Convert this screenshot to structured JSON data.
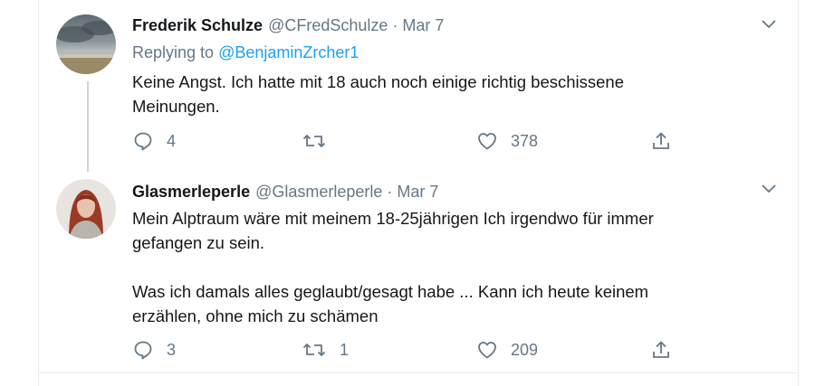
{
  "tweets": [
    {
      "name": "Frederik Schulze",
      "handle": "@CFredSchulze",
      "separator": "·",
      "date": "Mar 7",
      "reply_prefix": "Replying to",
      "reply_handle": "@BenjaminZrcher1",
      "text": "Keine Angst. Ich hatte mit 18 auch noch einige richtig beschissene\nMeinungen.",
      "replies": "4",
      "retweets": "",
      "likes": "378",
      "avatar": "storm-sky-avatar"
    },
    {
      "name": "Glasmerleperle",
      "handle": "@Glasmerleperle",
      "separator": "·",
      "date": "Mar 7",
      "text": "Mein Alptraum wäre mit meinem 18-25jährigen Ich irgendwo für immer\ngefangen zu sein.\n\nWas ich damals alles geglaubt/gesagt habe ... Kann ich heute keinem\nerzählen, ohne mich zu schämen",
      "replies": "3",
      "retweets": "1",
      "likes": "209",
      "avatar": "red-hair-woman-avatar"
    }
  ],
  "colors": {
    "text": "#14171a",
    "secondary": "#657786",
    "link": "#1da1f2",
    "border": "#e6ecf0",
    "thread": "#ccd6dd"
  },
  "icons": [
    "reply-icon",
    "retweet-icon",
    "like-icon",
    "share-icon",
    "chevron-down-icon"
  ]
}
